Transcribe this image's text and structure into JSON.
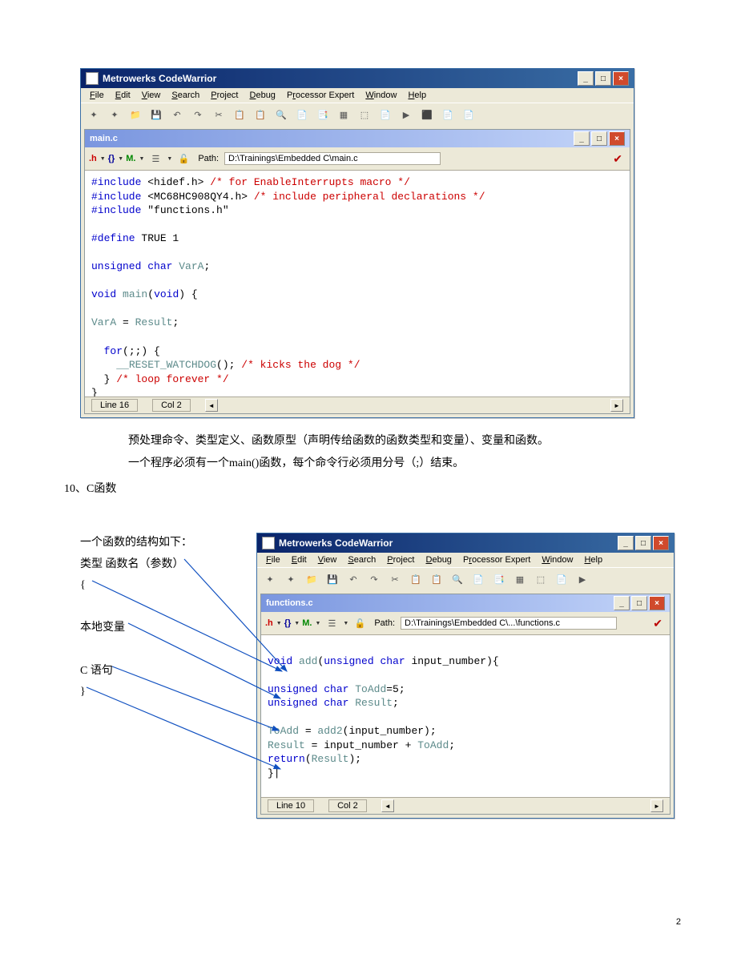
{
  "app_title": "Metrowerks CodeWarrior",
  "menus": [
    "File",
    "Edit",
    "View",
    "Search",
    "Project",
    "Debug",
    "Processor Expert",
    "Window",
    "Help"
  ],
  "menu_underline": [
    "F",
    "E",
    "V",
    "S",
    "P",
    "D",
    "r",
    "W",
    "H"
  ],
  "editor1": {
    "tab_title": "main.c",
    "path_label": "Path:",
    "path": "D:\\Trainings\\Embedded C\\main.c",
    "status_line": "Line 16",
    "status_col": "Col 2"
  },
  "editor2": {
    "tab_title": "functions.c",
    "path_label": "Path:",
    "path": "D:\\Trainings\\Embedded C\\...\\functions.c",
    "status_line": "Line 10",
    "status_col": "Col 2"
  },
  "code1_lines": [
    {
      "t": "#include",
      "c": "kw"
    },
    {
      "t": " <hidef.h> "
    },
    {
      "t": "/* for EnableInterrupts macro */",
      "c": "cm"
    },
    {
      "br": 1
    },
    {
      "t": "#include",
      "c": "kw"
    },
    {
      "t": " <MC68HC908QY4.h> "
    },
    {
      "t": "/* include peripheral declarations */",
      "c": "cm"
    },
    {
      "br": 1
    },
    {
      "t": "#include",
      "c": "kw"
    },
    {
      "t": " \"functions.h\""
    },
    {
      "br": 1
    },
    {
      "br": 1
    },
    {
      "t": "#define",
      "c": "kw"
    },
    {
      "t": " TRUE 1"
    },
    {
      "br": 1
    },
    {
      "br": 1
    },
    {
      "t": "unsigned char",
      "c": "kw"
    },
    {
      "t": " "
    },
    {
      "t": "VarA",
      "c": "fn"
    },
    {
      "t": ";"
    },
    {
      "br": 1
    },
    {
      "br": 1
    },
    {
      "t": "void",
      "c": "kw"
    },
    {
      "t": " "
    },
    {
      "t": "main",
      "c": "fn"
    },
    {
      "t": "("
    },
    {
      "t": "void",
      "c": "kw"
    },
    {
      "t": ") {"
    },
    {
      "br": 1
    },
    {
      "br": 1
    },
    {
      "t": "VarA",
      "c": "fn"
    },
    {
      "t": " = "
    },
    {
      "t": "Result",
      "c": "fn"
    },
    {
      "t": ";"
    },
    {
      "br": 1
    },
    {
      "br": 1
    },
    {
      "t": "  "
    },
    {
      "t": "for",
      "c": "kw"
    },
    {
      "t": "(;;) {"
    },
    {
      "br": 1
    },
    {
      "t": "    "
    },
    {
      "t": "__RESET_WATCHDOG",
      "c": "fn"
    },
    {
      "t": "(); "
    },
    {
      "t": "/* kicks the dog */",
      "c": "cm"
    },
    {
      "br": 1
    },
    {
      "t": "  } "
    },
    {
      "t": "/* loop forever */",
      "c": "cm"
    },
    {
      "br": 1
    },
    {
      "t": "}"
    }
  ],
  "code2_lines": [
    {
      "br": 1
    },
    {
      "t": "void",
      "c": "kw"
    },
    {
      "t": " "
    },
    {
      "t": "add",
      "c": "fn"
    },
    {
      "t": "("
    },
    {
      "t": "unsigned char",
      "c": "kw"
    },
    {
      "t": " input_number){"
    },
    {
      "br": 1
    },
    {
      "br": 1
    },
    {
      "t": "unsigned char",
      "c": "kw"
    },
    {
      "t": " "
    },
    {
      "t": "ToAdd",
      "c": "fn"
    },
    {
      "t": "=5;"
    },
    {
      "br": 1
    },
    {
      "t": "unsigned char",
      "c": "kw"
    },
    {
      "t": " "
    },
    {
      "t": "Result",
      "c": "fn"
    },
    {
      "t": ";"
    },
    {
      "br": 1
    },
    {
      "br": 1
    },
    {
      "t": "ToAdd",
      "c": "fn"
    },
    {
      "t": " = "
    },
    {
      "t": "add2",
      "c": "fn"
    },
    {
      "t": "(input_number);"
    },
    {
      "br": 1
    },
    {
      "t": "Result",
      "c": "fn"
    },
    {
      "t": " = input_number + "
    },
    {
      "t": "ToAdd",
      "c": "fn"
    },
    {
      "t": ";"
    },
    {
      "br": 1
    },
    {
      "t": "return",
      "c": "kw"
    },
    {
      "t": "("
    },
    {
      "t": "Result",
      "c": "fn"
    },
    {
      "t": ");"
    },
    {
      "br": 1
    },
    {
      "t": "}|"
    }
  ],
  "body": {
    "para1": "预处理命令、类型定义、函数原型（声明传给函数的函数类型和变量）、变量和函数。",
    "para2": "一个程序必须有一个main()函数，每个命令行必须用分号（;）结束。",
    "sec": "10、C函数",
    "struct_intro": "一个函数的结构如下：",
    "struct_sig": "类型  函数名（参数）",
    "struct_open": "{",
    "struct_local": "本地变量",
    "struct_stmt": "C 语句",
    "struct_close": "}"
  },
  "page_number": "2"
}
